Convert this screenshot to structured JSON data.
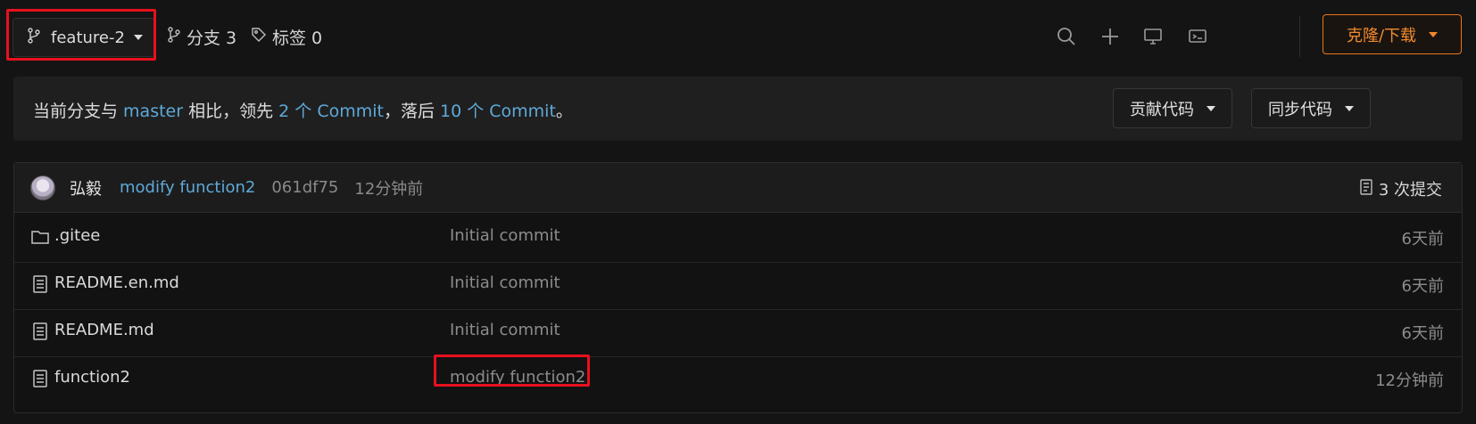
{
  "toolbar": {
    "branch": "feature-2",
    "branches_label": "分支 3",
    "tags_label": "标签 0",
    "clone_label": "克隆/下载",
    "icons": [
      "search-icon",
      "plus-icon",
      "monitor-icon",
      "terminal-icon"
    ]
  },
  "banner": {
    "prefix": "当前分支与 ",
    "base_branch": "master",
    "mid1": " 相比，领先 ",
    "ahead": "2 个 Commit",
    "mid2": "，落后 ",
    "behind": "10 个 Commit",
    "suffix": "。",
    "contribute_label": "贡献代码",
    "sync_label": "同步代码"
  },
  "latest_commit": {
    "author": "弘毅",
    "message": "modify function2",
    "sha": "061df75",
    "time": "12分钟前",
    "commits_count": "3 次提交"
  },
  "files": [
    {
      "name": ".gitee",
      "type": "folder",
      "message": "Initial commit",
      "time": "6天前"
    },
    {
      "name": "README.en.md",
      "type": "file",
      "message": "Initial commit",
      "time": "6天前"
    },
    {
      "name": "README.md",
      "type": "file",
      "message": "Initial commit",
      "time": "6天前"
    },
    {
      "name": "function2",
      "type": "file",
      "message": "modify function2",
      "time": "12分钟前"
    }
  ],
  "colors": {
    "accent_orange": "#f18a2d",
    "link_blue": "#5fa9d8",
    "highlight_red": "#e8101e"
  }
}
